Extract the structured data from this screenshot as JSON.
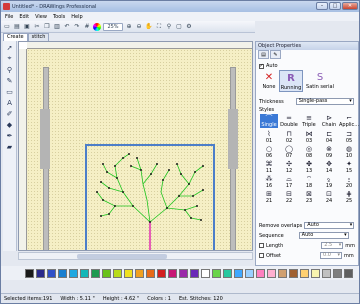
{
  "window": {
    "title": "Untitled* - DRAWings Professional",
    "min": "–",
    "max": "□",
    "close": "✕"
  },
  "menu": [
    "File",
    "Edit",
    "View",
    "Tools",
    "Help"
  ],
  "toolbar": {
    "zoom": "25%"
  },
  "mode_tabs": [
    "Create",
    "stitch"
  ],
  "panel": {
    "title": "Object Properties",
    "auto_checked": true,
    "auto_label": "Auto",
    "fill_buttons": [
      {
        "label": "None",
        "icon": "none-icon",
        "glyph": "✕",
        "color": "#d42020"
      },
      {
        "label": "Running",
        "icon": "running-icon",
        "glyph": "R",
        "color": "#8a5bb5"
      },
      {
        "label": "Satin serial",
        "icon": "satin-icon",
        "glyph": "S",
        "color": "#8a5bb5"
      }
    ],
    "thickness_label": "Thickness",
    "thickness_value": "Single-pass",
    "styles_label": "Styles",
    "style_types": [
      "Single",
      "Double",
      "Triple",
      "Chain",
      "Applic..."
    ],
    "pattern_numbers": [
      "01",
      "02",
      "03",
      "04",
      "05",
      "06",
      "07",
      "08",
      "09",
      "10",
      "11",
      "12",
      "13",
      "14",
      "15",
      "16",
      "17",
      "18",
      "19",
      "20",
      "21",
      "22",
      "23",
      "24",
      "25"
    ],
    "remove_overlaps_label": "Remove overlaps",
    "remove_overlaps_value": "Auto",
    "sequence_label": "Sequence",
    "sequence_value": "Auto",
    "length_label": "Length",
    "length_value": "2.5",
    "length_unit": "mm",
    "offset_label": "Offset",
    "offset_value": "0.0",
    "offset_unit": "mm"
  },
  "palette": [
    "#1a1a1a",
    "#2a2a8c",
    "#3050c8",
    "#1a7fd0",
    "#20a8e0",
    "#14b8b8",
    "#1e9a50",
    "#6ac21a",
    "#b8dc1a",
    "#f0e020",
    "#f0a020",
    "#e86a18",
    "#d42020",
    "#c81874",
    "#9a2aa8",
    "#6a2ab8",
    "#ffffff",
    "#6ad44a",
    "#28c8a0",
    "#40a8ff",
    "#9ad0ff",
    "#ff80c0",
    "#ffb0d0",
    "#d0a070",
    "#a06030",
    "#ffd070",
    "#f8f4b0",
    "#c0c0c0",
    "#808080",
    "#606060"
  ],
  "status": {
    "selected": "Selected items:191",
    "width": "Width : 5.11 \"",
    "height": "Height : 4.62 \"",
    "colors": "Colors : 1",
    "est": "Est. Stitches: 120"
  }
}
